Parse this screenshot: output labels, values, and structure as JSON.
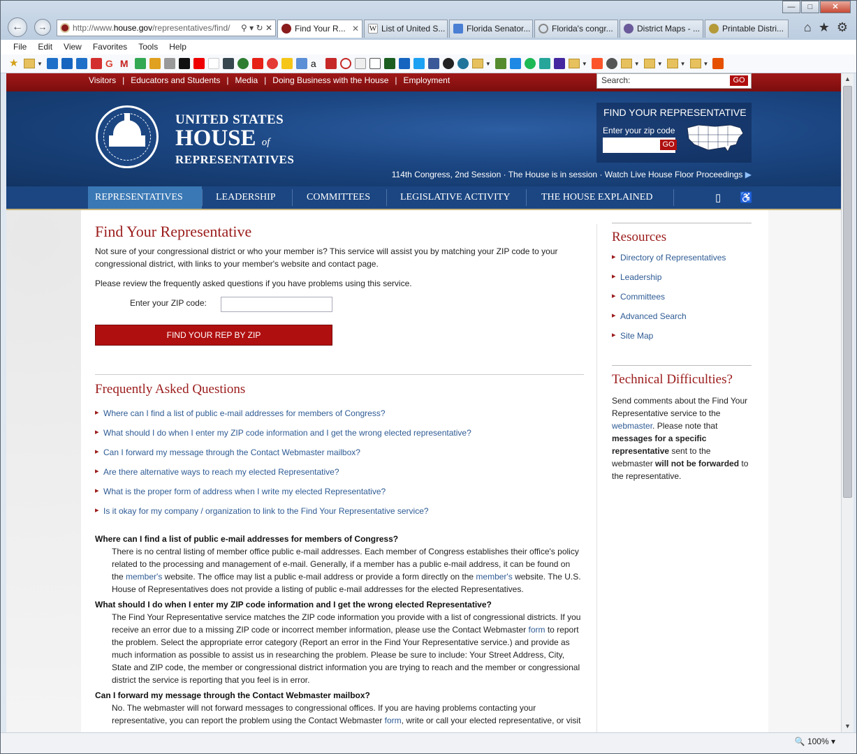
{
  "browser": {
    "address_prefix": "http://www.",
    "address_domain": "house.gov",
    "address_path": "/representatives/find/",
    "tabs": [
      {
        "label": "Find Your R...",
        "color": "#8a1c1c"
      },
      {
        "label": "List of United S...",
        "color": "#444444"
      },
      {
        "label": "Florida Senator...",
        "color": "#4a7fd4"
      },
      {
        "label": "Florida's congr...",
        "color": "#888888"
      },
      {
        "label": "District Maps - ...",
        "color": "#6a5a9a"
      },
      {
        "label": "Printable Distri...",
        "color": "#b59a3a"
      }
    ],
    "menu": [
      "File",
      "Edit",
      "View",
      "Favorites",
      "Tools",
      "Help"
    ],
    "zoom": "100%"
  },
  "util": {
    "links": [
      "Visitors",
      "Educators and Students",
      "Media",
      "Doing Business with the House",
      "Employment"
    ],
    "search_label": "Search:",
    "go": "GO"
  },
  "header": {
    "line1": "UNITED STATES",
    "line2": "HOUSE",
    "line2_of": "of",
    "line3": "REPRESENTATIVES",
    "find_title": "FIND YOUR REPRESENTATIVE",
    "find_zip_label": "Enter your zip code",
    "find_go": "GO",
    "session": "114th Congress, 2nd Session · The House is in session · Watch Live House Floor Proceedings"
  },
  "nav": {
    "items": [
      "REPRESENTATIVES",
      "LEADERSHIP",
      "COMMITTEES",
      "LEGISLATIVE ACTIVITY",
      "THE HOUSE EXPLAINED"
    ]
  },
  "main": {
    "title": "Find Your Representative",
    "intro": "Not sure of your congressional district or who your member is? This service will assist you by matching your ZIP code to your congressional district, with links to your member's website and contact page.",
    "review": "Please review the frequently asked questions if you have problems using this service.",
    "zip_label": "Enter your ZIP code:",
    "button": "FIND YOUR REP BY ZIP",
    "faq_title": "Frequently Asked Questions",
    "faq": [
      "Where can I find a list of public e-mail addresses for members of Congress?",
      "What should I do when I enter my ZIP code information and I get the wrong elected representative?",
      "Can I forward my message through the Contact Webmaster mailbox?",
      "Are there alternative ways to reach my elected Representative?",
      "What is the proper form of address when I write my elected Representative?",
      "Is it okay for my company / organization to link to the Find Your Representative service?"
    ],
    "q1": "Where can I find a list of public e-mail addresses for members of Congress?",
    "a1_a": "There is no central listing of member office public e-mail addresses. Each member of Congress establishes their office's policy related to the processing and management of e-mail. Generally, if a member has a public e-mail address, it can be found on the ",
    "a1_link1": "member's",
    "a1_b": " website. The office may list a public e-mail address or provide a form directly on the ",
    "a1_link2": "member's",
    "a1_c": " website. The U.S. House of Representatives does not provide a listing of public e-mail addresses for the elected Representatives.",
    "q2": "What should I do when I enter my ZIP code information and I get the wrong elected Representative?",
    "a2_a": "The Find Your Representative service matches the ZIP code information you provide with a list of congressional districts. If you receive an error due to a missing ZIP code or incorrect member information, please use the Contact Webmaster ",
    "a2_link": "form",
    "a2_b": " to report the problem. Select the appropriate error category (Report an error in the Find Your Representative service.) and provide as much information as possible to assist us in researching the problem. Please be sure to include: Your Street Address, City, State and ZIP code, the member or congressional district information you are trying to reach and the member or congressional district the service is reporting that you feel is in error.",
    "q3": "Can I forward my message through the Contact Webmaster mailbox?",
    "a3_a": "No. The webmaster will not forward messages to congressional offices. If you are having problems contacting your representative, you can report the problem using the Contact Webmaster ",
    "a3_link": "form",
    "a3_b": ", write or call your elected representative, or visit"
  },
  "sidebar": {
    "resources_title": "Resources",
    "resources": [
      "Directory of Representatives",
      "Leadership",
      "Committees",
      "Advanced Search",
      "Site Map"
    ],
    "tech_title": "Technical Difficulties?",
    "tech_a": "Send comments about the Find Your Representative service to the ",
    "tech_link": "webmaster",
    "tech_b": ". Please note that ",
    "tech_bold1": "messages for a specific representative",
    "tech_c": " sent to the webmaster ",
    "tech_bold2": "will not be forwarded",
    "tech_d": " to the representative."
  },
  "colors": {
    "house_red": "#9b1b1b",
    "nav_blue": "#1b4682",
    "link_blue": "#2e5b94",
    "button_red": "#b00f0f"
  }
}
